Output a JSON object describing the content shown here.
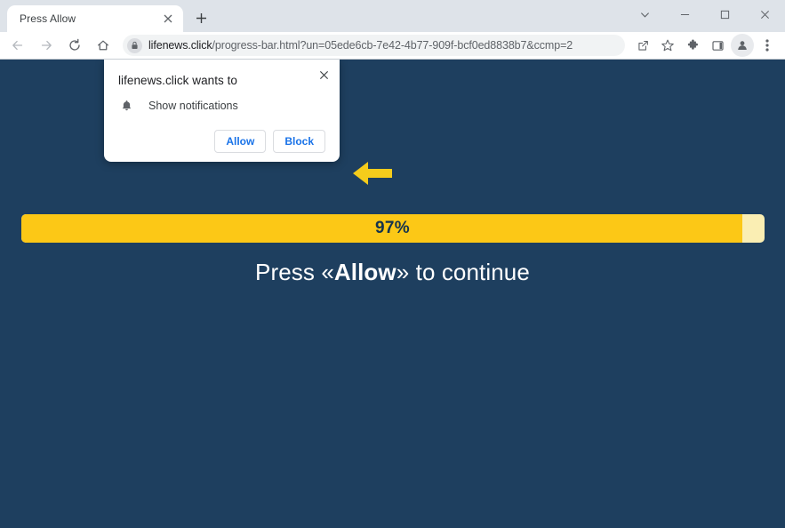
{
  "window": {
    "controls": [
      {
        "name": "tab-search-button",
        "glyph": "chevron-down"
      },
      {
        "name": "minimize-button",
        "glyph": "minimize"
      },
      {
        "name": "maximize-button",
        "glyph": "maximize"
      },
      {
        "name": "close-window-button",
        "glyph": "close"
      }
    ]
  },
  "tabstrip": {
    "tab_title": "Press Allow",
    "close_tab_label": "×",
    "new_tab_label": "+"
  },
  "toolbar": {
    "nav": [
      {
        "name": "back-button",
        "label": "Back"
      },
      {
        "name": "forward-button",
        "label": "Forward"
      },
      {
        "name": "reload-button",
        "label": "Reload"
      },
      {
        "name": "home-button",
        "label": "Home"
      }
    ],
    "omnibox": {
      "security_icon": "lock-icon",
      "url_domain": "lifenews.click",
      "url_path": "/progress-bar.html?un=05ede6cb-7e42-4b77-909f-bcf0ed8838b7&ccmp=2",
      "full_url": "lifenews.click/progress-bar.html?un=05ede6cb-7e42-4b77-909f-bcf0ed8838b7&ccmp=2"
    },
    "actions": [
      {
        "name": "share-icon",
        "label": "Share"
      },
      {
        "name": "bookmark-star-icon",
        "label": "Bookmark this tab"
      },
      {
        "name": "extensions-puzzle-icon",
        "label": "Extensions"
      },
      {
        "name": "side-panel-icon",
        "label": "Side panel"
      },
      {
        "name": "profile-avatar-icon",
        "label": "Profile"
      },
      {
        "name": "more-menu-icon",
        "label": "Customize and control Google Chrome"
      }
    ]
  },
  "permission_dialog": {
    "title": "lifenews.click wants to",
    "permission_label": "Show notifications",
    "permission_icon": "bell-icon",
    "allow_label": "Allow",
    "block_label": "Block",
    "close_label": "×"
  },
  "page": {
    "background_color": "#1e3f5f",
    "arrow": {
      "name": "left-arrow-pointer",
      "color": "#f5cc1b",
      "direction": "left"
    },
    "progress": {
      "percent_label": "97%",
      "percent_value": 97,
      "fill_color": "#fcc816",
      "track_color": "#faeeb3",
      "text_color": "#15334d"
    },
    "headline": {
      "before": "Press «",
      "emphasis": "Allow",
      "after": "» to continue"
    }
  }
}
